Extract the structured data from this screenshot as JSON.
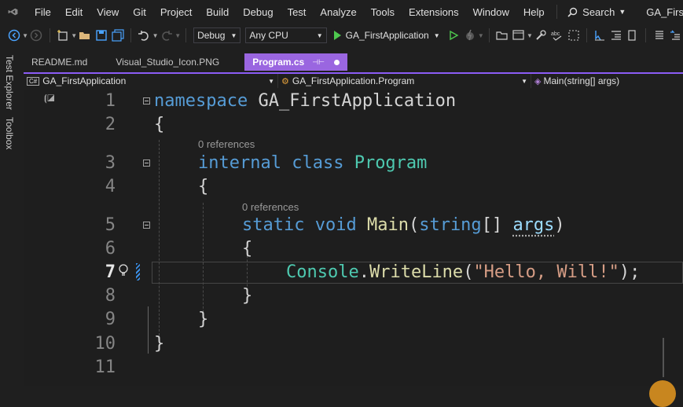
{
  "menu": [
    "File",
    "Edit",
    "View",
    "Git",
    "Project",
    "Build",
    "Debug",
    "Test",
    "Analyze",
    "Tools",
    "Extensions",
    "Window",
    "Help"
  ],
  "search_label": "Search",
  "window_title": "GA_FirstApplic",
  "toolbar": {
    "config": "Debug",
    "platform": "Any CPU",
    "run_target": "GA_FirstApplication"
  },
  "side_tabs": [
    "Test Explorer",
    "Toolbox"
  ],
  "tabs": [
    {
      "label": "README.md"
    },
    {
      "label": "Visual_Studio_Icon.PNG"
    },
    {
      "label": "Program.cs",
      "pin": "⊣⊢"
    }
  ],
  "nav": {
    "project": "GA_FirstApplication",
    "class": "GA_FirstApplication.Program",
    "member": "Main(string[] args)"
  },
  "codelens": "0 references",
  "lines": {
    "n1": "1",
    "n2": "2",
    "n3": "3",
    "n4": "4",
    "n5": "5",
    "n6": "6",
    "n7": "7",
    "n8": "8",
    "n9": "9",
    "n10": "10",
    "n11": "11"
  },
  "code": {
    "l1_kw": "namespace",
    "l1_name": " GA_FirstApplication",
    "l2": "{",
    "l3_kw1": "internal",
    "l3_kw2": " class",
    "l3_name": " Program",
    "l4": "{",
    "l5_kw1": "static",
    "l5_kw2": " void",
    "l5_fn": " Main",
    "l5_p1": "(",
    "l5_kw3": "string",
    "l5_p2": "[] ",
    "l5_arg": "args",
    "l5_p3": ")",
    "l6": "{",
    "l7_ty": "Console",
    "l7_dot": ".",
    "l7_fn": "WriteLine",
    "l7_p1": "(",
    "l7_str": "\"Hello, Will!\"",
    "l7_p2": ");",
    "l8": "}",
    "l9": "}",
    "l10": "}"
  },
  "colors": {
    "accent": "#9a66e0",
    "keyword": "#569cd6",
    "type": "#4ec9b0",
    "method": "#dcdcaa",
    "string": "#d69d85"
  }
}
